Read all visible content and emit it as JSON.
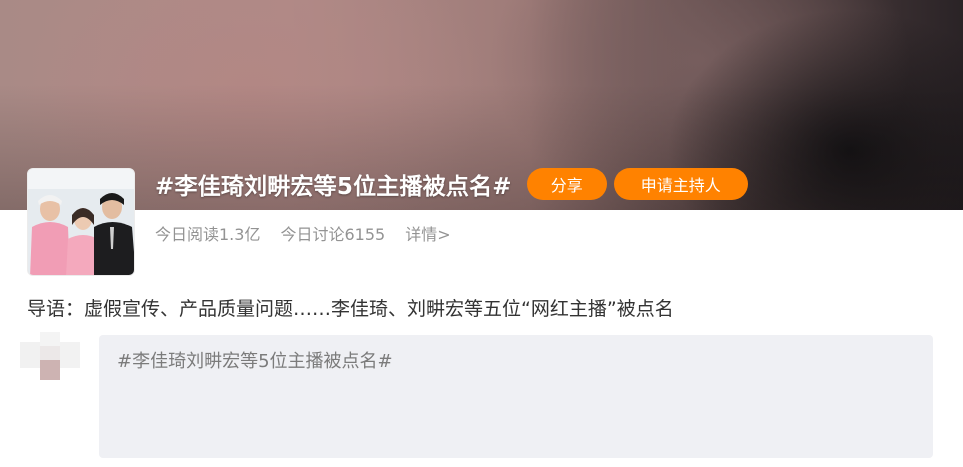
{
  "topic": {
    "title": "#李佳琦刘畊宏等5位主播被点名#",
    "share_label": "分享",
    "host_label": "申请主持人"
  },
  "stats": {
    "reads": "今日阅读1.3亿",
    "discussions": "今日讨论6155",
    "detail": "详情>"
  },
  "intro": "导语：虚假宣传、产品质量问题……李佳琦、刘畊宏等五位“网红主播”被点名",
  "composer": {
    "text": "#李佳琦刘畊宏等5位主播被点名#"
  },
  "colors": {
    "accent": "#ff8200",
    "composer_bg": "#eff0f4"
  }
}
